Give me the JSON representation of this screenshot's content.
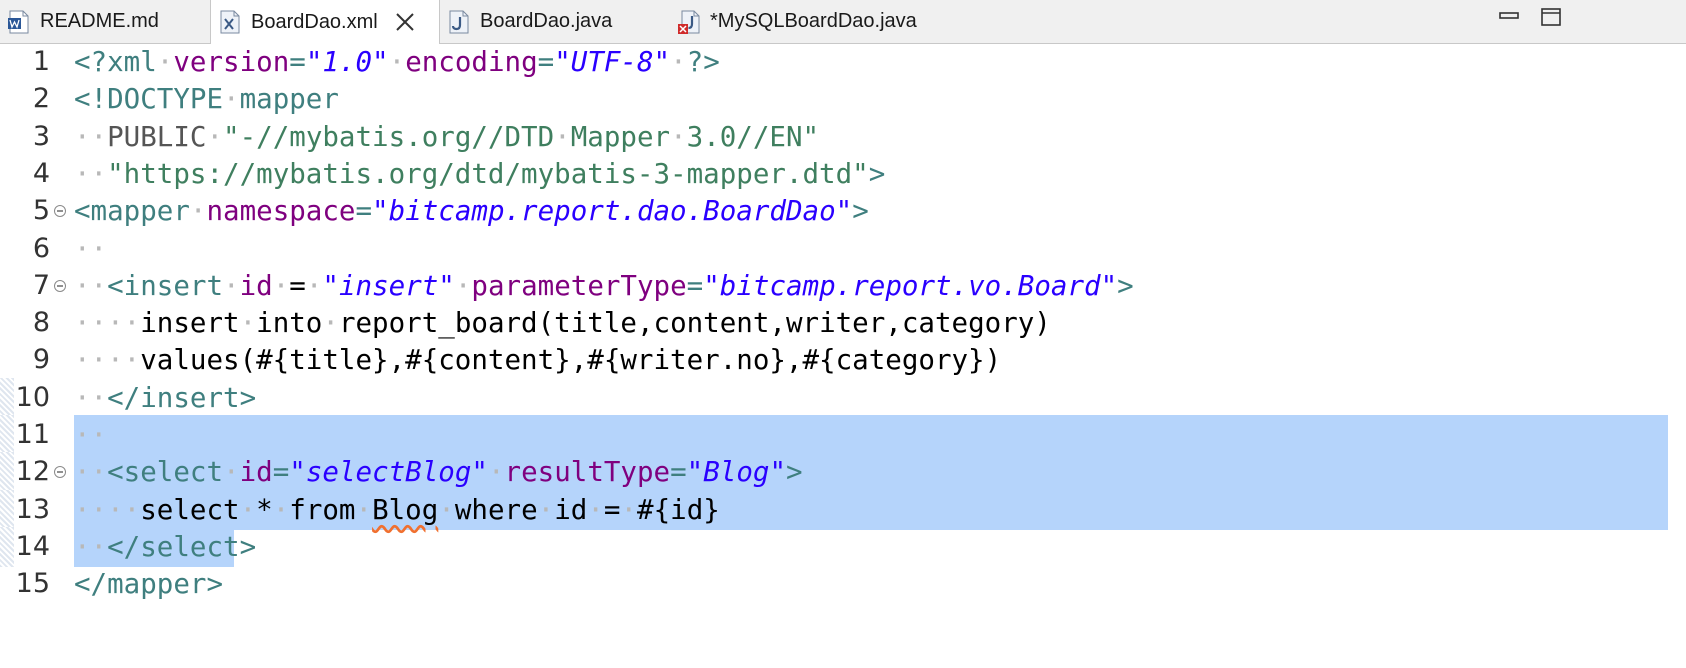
{
  "tabs": [
    {
      "label": "README.md",
      "icon": "word-document-icon",
      "active": false
    },
    {
      "label": "BoardDao.xml",
      "icon": "xml-file-icon",
      "active": true
    },
    {
      "label": "BoardDao.java",
      "icon": "java-file-icon",
      "active": false
    },
    {
      "label": "*MySQLBoardDao.java",
      "icon": "java-file-error-icon",
      "active": false
    }
  ],
  "window_controls": [
    "minimize-icon",
    "maximize-icon"
  ],
  "colors": {
    "tag": "#3f7f7f",
    "attribute": "#7f007f",
    "string": "#2a00ff",
    "doctype": "#3f7f5f",
    "selection": "#b5d4fb"
  },
  "editor": {
    "lines": [
      {
        "no": "1",
        "parts": [
          [
            "tag",
            "<?xml"
          ],
          [
            "ws",
            "·"
          ],
          [
            "attr",
            "version"
          ],
          [
            "tag",
            "="
          ],
          [
            "str",
            "\"1.0\""
          ],
          [
            "ws",
            "·"
          ],
          [
            "attr",
            "encoding"
          ],
          [
            "tag",
            "="
          ],
          [
            "str",
            "\"UTF-8\""
          ],
          [
            "ws",
            "·"
          ],
          [
            "tag",
            "?>"
          ]
        ]
      },
      {
        "no": "2",
        "parts": [
          [
            "tag",
            "<!DOCTYPE"
          ],
          [
            "ws",
            "·"
          ],
          [
            "tag",
            "mapper"
          ]
        ]
      },
      {
        "no": "3",
        "parts": [
          [
            "ws",
            "··"
          ],
          [
            "pub",
            "PUBLIC"
          ],
          [
            "ws",
            "·"
          ],
          [
            "doc",
            "\"-//mybatis.org//DTD"
          ],
          [
            "ws",
            "·"
          ],
          [
            "doc",
            "Mapper"
          ],
          [
            "ws",
            "·"
          ],
          [
            "doc",
            "3.0//EN\""
          ]
        ]
      },
      {
        "no": "4",
        "parts": [
          [
            "ws",
            "··"
          ],
          [
            "doc",
            "\"https://mybatis.org/dtd/mybatis-3-mapper.dtd\""
          ],
          [
            "tag",
            ">"
          ]
        ]
      },
      {
        "no": "5",
        "fold": true,
        "parts": [
          [
            "tag",
            "<mapper"
          ],
          [
            "ws",
            "·"
          ],
          [
            "attr",
            "namespace"
          ],
          [
            "tag",
            "="
          ],
          [
            "str",
            "\"bitcamp.report.dao.BoardDao\""
          ],
          [
            "tag",
            ">"
          ]
        ]
      },
      {
        "no": "6",
        "parts": [
          [
            "ws",
            "··"
          ]
        ]
      },
      {
        "no": "7",
        "fold": true,
        "parts": [
          [
            "ws",
            "··"
          ],
          [
            "tag",
            "<insert"
          ],
          [
            "ws",
            "·"
          ],
          [
            "attr",
            "id"
          ],
          [
            "ws",
            "·"
          ],
          [
            "txt",
            "="
          ],
          [
            "ws",
            "·"
          ],
          [
            "str",
            "\"insert\""
          ],
          [
            "ws",
            "·"
          ],
          [
            "attr",
            "parameterType"
          ],
          [
            "tag",
            "="
          ],
          [
            "str",
            "\"bitcamp.report.vo.Board\""
          ],
          [
            "tag",
            ">"
          ]
        ]
      },
      {
        "no": "8",
        "parts": [
          [
            "ws",
            "····"
          ],
          [
            "txt",
            "insert"
          ],
          [
            "ws",
            "·"
          ],
          [
            "txt",
            "into"
          ],
          [
            "ws",
            "·"
          ],
          [
            "txt",
            "report_board(title,content,writer,category)"
          ]
        ]
      },
      {
        "no": "9",
        "parts": [
          [
            "ws",
            "····"
          ],
          [
            "txt",
            "values(#{title},#{content},#{writer.no},#{category})"
          ]
        ]
      },
      {
        "no": "10",
        "ruler": true,
        "parts": [
          [
            "ws",
            "··"
          ],
          [
            "tag",
            "</insert>"
          ]
        ]
      },
      {
        "no": "11",
        "ruler": true,
        "selected": true,
        "parts": [
          [
            "ws",
            "··"
          ]
        ]
      },
      {
        "no": "12",
        "ruler": true,
        "selected": true,
        "fold": true,
        "parts": [
          [
            "ws",
            "··"
          ],
          [
            "tag",
            "<select"
          ],
          [
            "ws",
            "·"
          ],
          [
            "attr",
            "id"
          ],
          [
            "tag",
            "="
          ],
          [
            "str",
            "\"selectBlog\""
          ],
          [
            "ws",
            "·"
          ],
          [
            "attr",
            "resultType"
          ],
          [
            "tag",
            "="
          ],
          [
            "str",
            "\"Blog\""
          ],
          [
            "tag",
            ">"
          ]
        ]
      },
      {
        "no": "13",
        "ruler": true,
        "selected": true,
        "parts": [
          [
            "ws",
            "····"
          ],
          [
            "txt",
            "select"
          ],
          [
            "ws",
            "·"
          ],
          [
            "txt",
            "*"
          ],
          [
            "ws",
            "·"
          ],
          [
            "txt",
            "from"
          ],
          [
            "ws",
            "·"
          ],
          [
            "warn",
            "Blog"
          ],
          [
            "ws",
            "·"
          ],
          [
            "txt",
            "where"
          ],
          [
            "ws",
            "·"
          ],
          [
            "txt",
            "id"
          ],
          [
            "ws",
            "·"
          ],
          [
            "txt",
            "="
          ],
          [
            "ws",
            "·"
          ],
          [
            "txt",
            "#{id}"
          ]
        ]
      },
      {
        "no": "14",
        "ruler": true,
        "selected": true,
        "partial": true,
        "parts": [
          [
            "ws",
            "··"
          ],
          [
            "tag",
            "</select>"
          ]
        ]
      },
      {
        "no": "15",
        "parts": [
          [
            "tag",
            "</mapper>"
          ]
        ]
      }
    ]
  }
}
